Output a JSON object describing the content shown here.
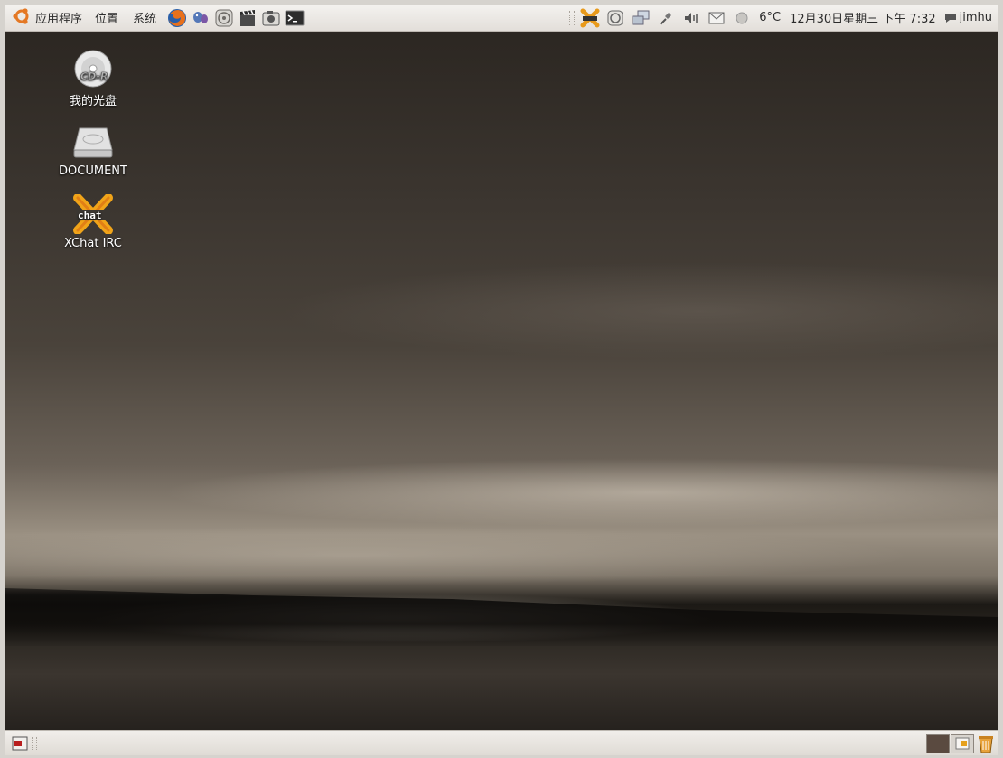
{
  "top_panel": {
    "menus": {
      "applications": "应用程序",
      "places": "位置",
      "system": "系统"
    },
    "launchers": [
      "firefox-icon",
      "pidgin-icon",
      "sound-juicer-icon",
      "movie-player-icon",
      "screenshot-icon",
      "terminal-icon"
    ],
    "tray": {
      "weather": "6°C",
      "clock": "12月30日星期三 下午 7:32",
      "user": "jimhu"
    }
  },
  "desktop": {
    "icons": [
      {
        "label": "我的光盘",
        "icon": "cd-r-icon"
      },
      {
        "label": "DOCUMENT",
        "icon": "drive-icon"
      },
      {
        "label": "XChat IRC",
        "icon": "xchat-icon"
      }
    ]
  },
  "colors": {
    "panel": "#e8e5e1",
    "accent_orange": "#e88d25"
  }
}
